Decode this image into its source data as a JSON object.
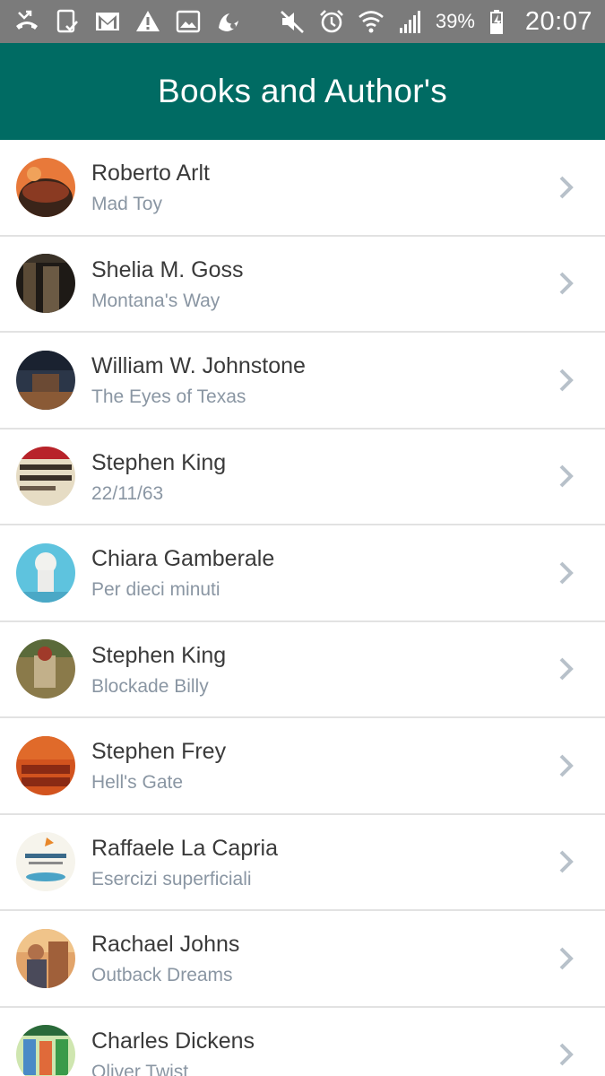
{
  "status_bar": {
    "icons": [
      "missed-call-icon",
      "clipboard-check-icon",
      "gmail-icon",
      "warning-icon",
      "image-icon",
      "uc-browser-icon",
      "mute-icon",
      "alarm-icon",
      "wifi-icon",
      "signal-icon",
      "battery-charging-icon"
    ],
    "battery": "39%",
    "time": "20:07"
  },
  "app_bar": {
    "title": "Books and Author's"
  },
  "colors": {
    "status_bar": "#7b7b7b",
    "app_bar": "#006b63",
    "subtitle": "#8a96a3",
    "chevron": "#b8c1ca"
  },
  "books": [
    {
      "author": "Roberto Arlt",
      "title": "Mad Toy"
    },
    {
      "author": "Shelia M. Goss",
      "title": "Montana's Way"
    },
    {
      "author": "William W. Johnstone",
      "title": "The Eyes of Texas"
    },
    {
      "author": "Stephen King",
      "title": "22/11/63"
    },
    {
      "author": "Chiara Gamberale",
      "title": "Per dieci minuti"
    },
    {
      "author": "Stephen King",
      "title": "Blockade Billy"
    },
    {
      "author": "Stephen Frey",
      "title": "Hell's Gate"
    },
    {
      "author": "Raffaele La Capria",
      "title": "Esercizi superficiali"
    },
    {
      "author": "Rachael Johns",
      "title": "Outback Dreams"
    },
    {
      "author": "Charles Dickens",
      "title": "Oliver Twist"
    }
  ]
}
